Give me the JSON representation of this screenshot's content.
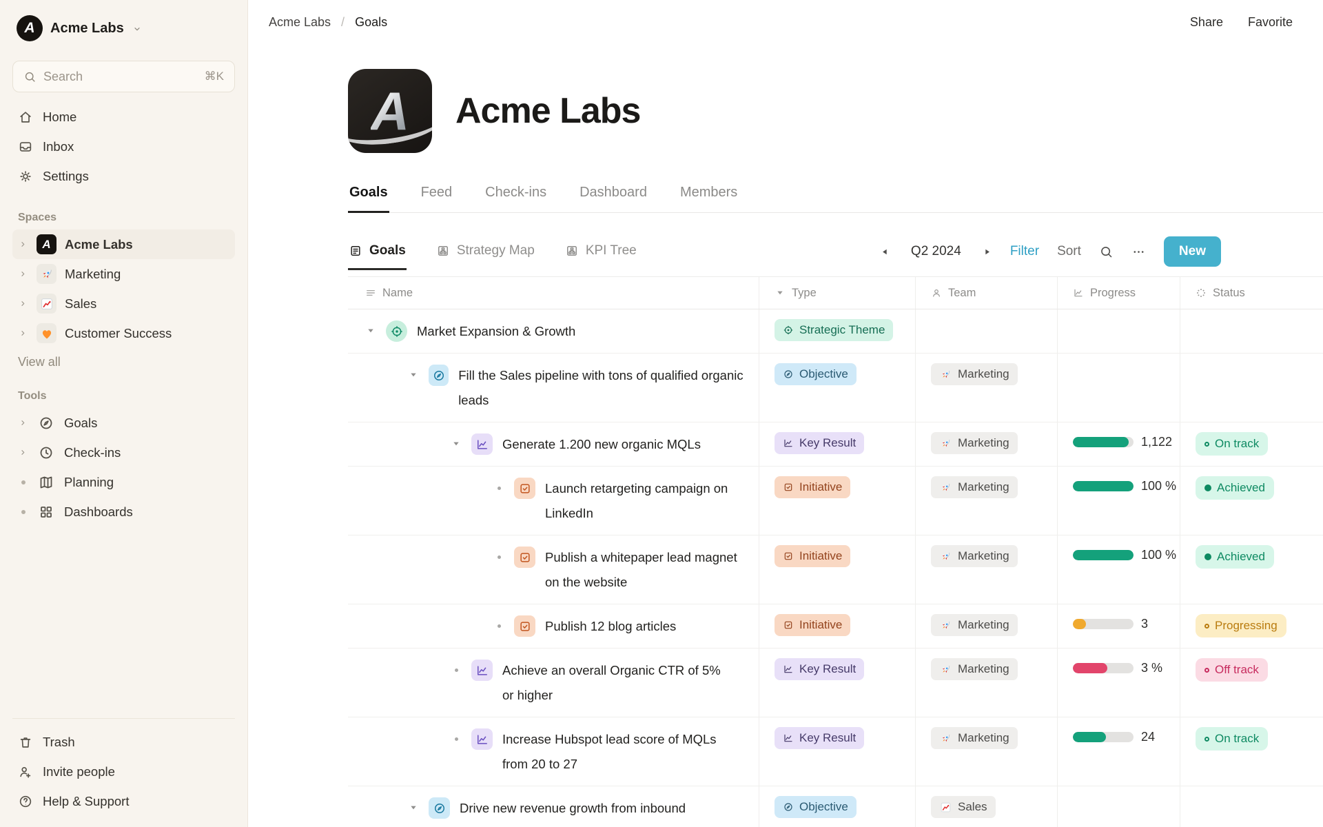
{
  "sidebar": {
    "workspace_name": "Acme Labs",
    "search": {
      "placeholder": "Search",
      "shortcut": "⌘K"
    },
    "nav": [
      {
        "icon": "home-icon",
        "label": "Home"
      },
      {
        "icon": "inbox-icon",
        "label": "Inbox"
      },
      {
        "icon": "gear-icon",
        "label": "Settings"
      }
    ],
    "spaces_label": "Spaces",
    "spaces": [
      {
        "icon": "acme-logo",
        "label": "Acme Labs",
        "bold": true
      },
      {
        "icon": "rocket-icon",
        "label": "Marketing"
      },
      {
        "icon": "chart-up-icon",
        "label": "Sales"
      },
      {
        "icon": "heart-icon",
        "label": "Customer Success"
      }
    ],
    "view_all": "View all",
    "tools_label": "Tools",
    "tools": [
      {
        "icon": "compass-icon",
        "label": "Goals",
        "marker": "chevron"
      },
      {
        "icon": "clock-icon",
        "label": "Check-ins",
        "marker": "chevron"
      },
      {
        "icon": "map-icon",
        "label": "Planning",
        "marker": "dot"
      },
      {
        "icon": "grid-icon",
        "label": "Dashboards",
        "marker": "dot"
      }
    ],
    "footer": [
      {
        "icon": "trash-icon",
        "label": "Trash"
      },
      {
        "icon": "invite-icon",
        "label": "Invite people"
      },
      {
        "icon": "help-icon",
        "label": "Help & Support"
      }
    ]
  },
  "topbar": {
    "breadcrumb": {
      "root": "Acme Labs",
      "separator": "/",
      "current": "Goals"
    },
    "actions": [
      "Share",
      "Favorite"
    ]
  },
  "hero": {
    "title": "Acme Labs"
  },
  "tabs": [
    {
      "label": "Goals",
      "active": true
    },
    {
      "label": "Feed",
      "active": false
    },
    {
      "label": "Check-ins",
      "active": false
    },
    {
      "label": "Dashboard",
      "active": false
    },
    {
      "label": "Members",
      "active": false
    }
  ],
  "toolbar": {
    "views": [
      {
        "icon": "doc-list-icon",
        "label": "Goals",
        "active": true
      },
      {
        "icon": "sitemap-icon",
        "label": "Strategy Map",
        "active": false
      },
      {
        "icon": "sitemap-icon",
        "label": "KPI Tree",
        "active": false
      }
    ],
    "period": "Q2 2024",
    "filter_label": "Filter",
    "sort_label": "Sort",
    "new_label": "New"
  },
  "table": {
    "columns": [
      {
        "icon": "hamburger-icon",
        "label": "Name"
      },
      {
        "icon": "triangle-down-icon",
        "label": "Type"
      },
      {
        "icon": "person-icon",
        "label": "Team"
      },
      {
        "icon": "chartline-icon",
        "label": "Progress"
      },
      {
        "icon": "spinner-icon",
        "label": "Status"
      }
    ],
    "rows": [
      {
        "level": 0,
        "marker": "arrow",
        "icon": "target-icon",
        "name": "Market Expansion & Growth",
        "type": "Strategic Theme",
        "type_kind": "theme",
        "team": null,
        "team_icon": null,
        "progress": null,
        "status": null
      },
      {
        "level": 1,
        "marker": "arrow",
        "icon": "objective-icon",
        "name": "Fill the Sales pipeline with tons of qualified organic leads",
        "type": "Objective",
        "type_kind": "objective",
        "team": "Marketing",
        "team_icon": "rocket-icon",
        "progress": null,
        "status": null
      },
      {
        "level": 2,
        "marker": "arrow",
        "icon": "keyresult-icon",
        "name": "Generate 1.200 new organic MQLs",
        "type": "Key Result",
        "type_kind": "key-result",
        "team": "Marketing",
        "team_icon": "rocket-icon",
        "progress": {
          "label": "1,122",
          "pct": 92,
          "color": "teal"
        },
        "status": {
          "label": "On track",
          "kind": "on-track",
          "dot": "outline"
        }
      },
      {
        "level": 3,
        "marker": "dot",
        "icon": "initiative-icon",
        "name": "Launch retargeting campaign on LinkedIn",
        "type": "Initiative",
        "type_kind": "initiative",
        "team": "Marketing",
        "team_icon": "rocket-icon",
        "progress": {
          "label": "100 %",
          "pct": 100,
          "color": "teal"
        },
        "status": {
          "label": "Achieved",
          "kind": "achieved",
          "dot": "filled"
        }
      },
      {
        "level": 3,
        "marker": "dot",
        "icon": "initiative-icon",
        "name": "Publish a whitepaper lead magnet on the website",
        "type": "Initiative",
        "type_kind": "initiative",
        "team": "Marketing",
        "team_icon": "rocket-icon",
        "progress": {
          "label": "100 %",
          "pct": 100,
          "color": "teal"
        },
        "status": {
          "label": "Achieved",
          "kind": "achieved",
          "dot": "filled"
        }
      },
      {
        "level": 3,
        "marker": "dot",
        "icon": "initiative-icon",
        "name": "Publish 12 blog articles",
        "type": "Initiative",
        "type_kind": "initiative",
        "team": "Marketing",
        "team_icon": "rocket-icon",
        "progress": {
          "label": "3",
          "pct": 22,
          "color": "orange"
        },
        "status": {
          "label": "Progressing",
          "kind": "progressing",
          "dot": "outline"
        }
      },
      {
        "level": 2,
        "marker": "dot",
        "icon": "keyresult-icon",
        "name": "Achieve an overall Organic CTR of 5% or higher",
        "type": "Key Result",
        "type_kind": "key-result",
        "team": "Marketing",
        "team_icon": "rocket-icon",
        "progress": {
          "label": "3 %",
          "pct": 57,
          "color": "red"
        },
        "status": {
          "label": "Off track",
          "kind": "off-track",
          "dot": "outline"
        }
      },
      {
        "level": 2,
        "marker": "dot",
        "icon": "keyresult-icon",
        "name": "Increase Hubspot lead score of MQLs from 20 to 27",
        "type": "Key Result",
        "type_kind": "key-result",
        "team": "Marketing",
        "team_icon": "rocket-icon",
        "progress": {
          "label": "24",
          "pct": 55,
          "color": "teal"
        },
        "status": {
          "label": "On track",
          "kind": "on-track",
          "dot": "outline"
        }
      },
      {
        "level": 1,
        "marker": "arrow",
        "icon": "objective-icon",
        "name": "Drive new revenue growth from inbound",
        "type": "Objective",
        "type_kind": "objective",
        "team": "Sales",
        "team_icon": "chart-up-icon",
        "progress": null,
        "status": null
      }
    ]
  },
  "colors": {
    "new_button": "#45b1cd",
    "filter_link": "#2e9fc4",
    "progress_teal": "#14a17b",
    "progress_orange": "#f0a92e",
    "progress_red": "#e2456b",
    "status_on_track_bg": "#d7f6e9",
    "status_progressing_bg": "#fcedc4",
    "status_off_track_bg": "#fbdbe4",
    "sidebar_bg": "#f8f4ee"
  }
}
